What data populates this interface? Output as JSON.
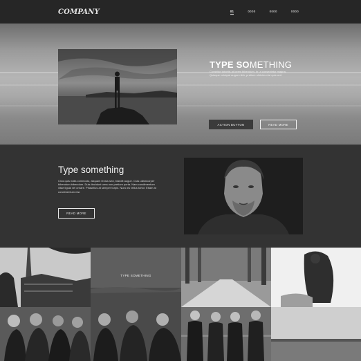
{
  "nav": {
    "logo": "COMPANY",
    "links": [
      {
        "label": "01",
        "active": true
      },
      {
        "label": "0000",
        "active": false
      },
      {
        "label": "0000",
        "active": false
      },
      {
        "label": "0000",
        "active": false
      }
    ]
  },
  "hero": {
    "title_bold": "TYPE SO",
    "title_rest": "METHING",
    "text": "Curabitur lobortis at lorem bibendum. In ut consectetur magna. Quisque volutpat augue nibh, pretium ultricies nisl quis a el.",
    "action_label": "ACTION BUTTON",
    "read_label": "READ MORE"
  },
  "about": {
    "title": "Type something",
    "text": "Cras quis nulla commodo, aliquam lectus sed, blandit augue. Cras ullamcorper bibendum bibendum. Duis tincidunt urna non pretium porta. Nam condimentum vitae ligula vel ornare. Phasellus at semper turpis. Nunc eu tellus tortor. Etiam at condimentum nisi.",
    "read_label": "READ MORE"
  },
  "gallery": {
    "caption": "TYPE SOMETHING"
  },
  "colors": {
    "nav_bg": "#262626",
    "about_bg": "#333333",
    "button_dark": "#3b3b3b"
  }
}
